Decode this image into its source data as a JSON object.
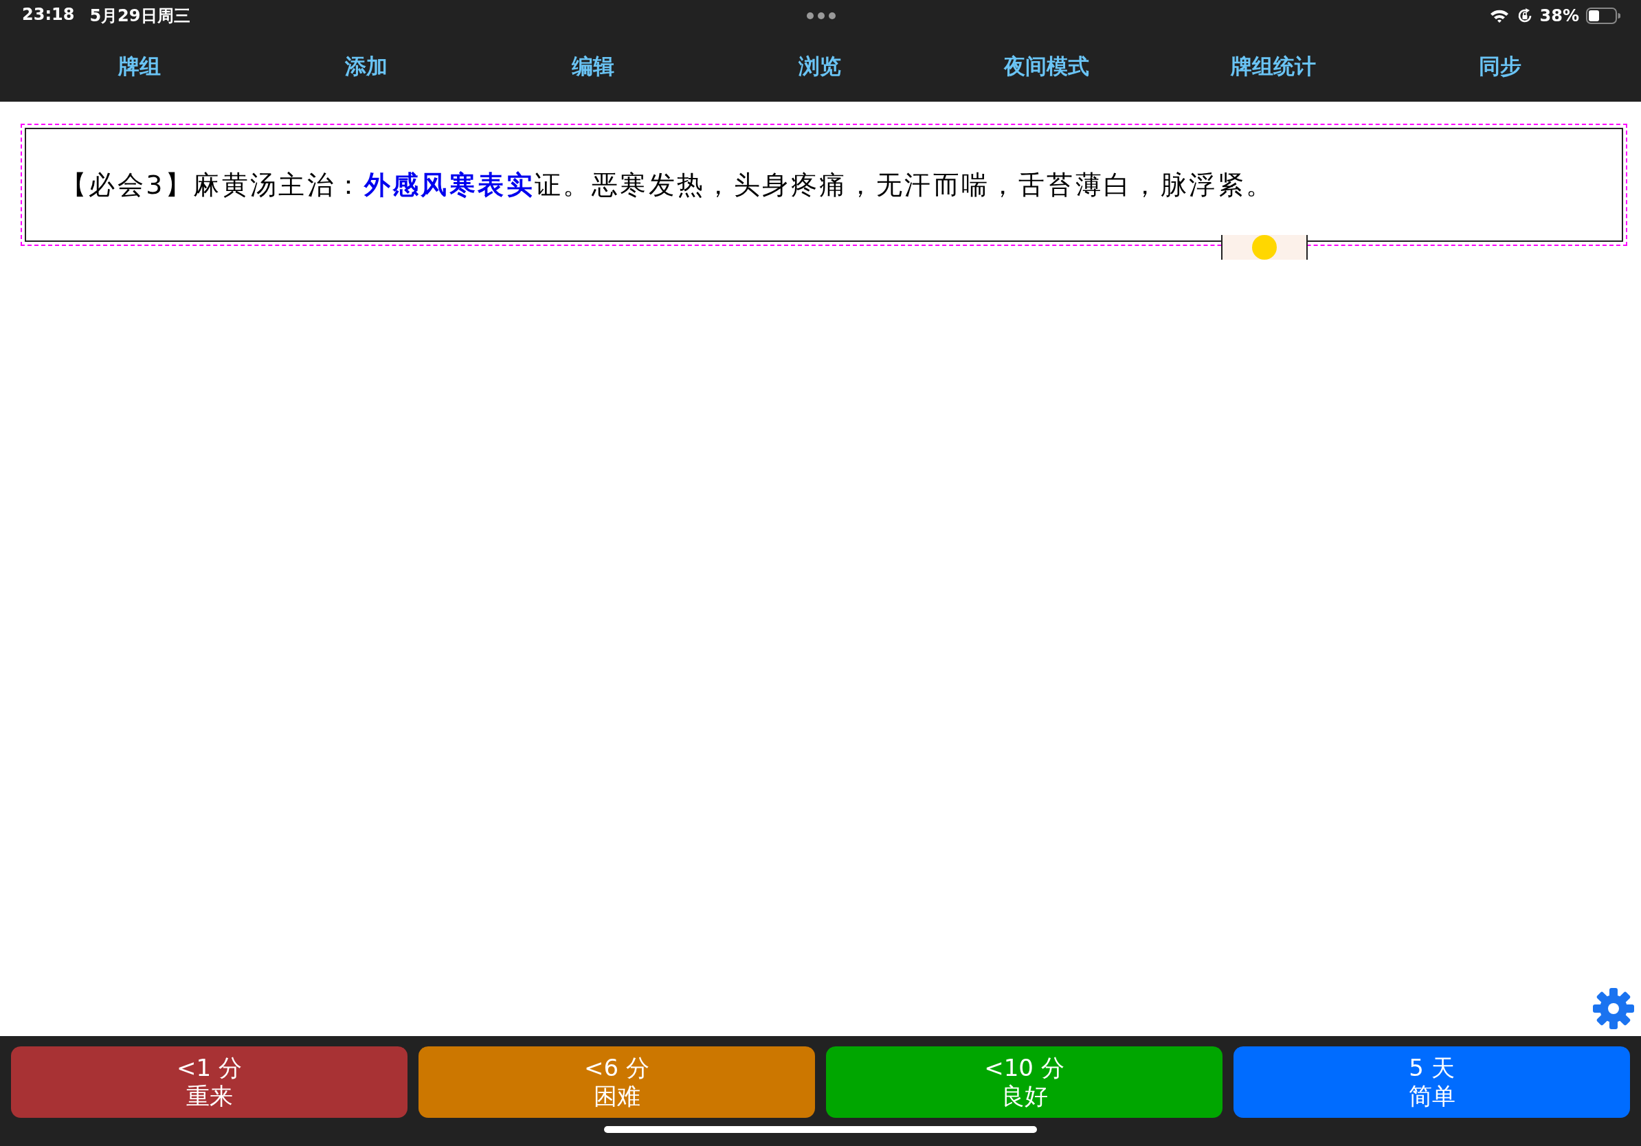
{
  "status_bar": {
    "time": "23:18",
    "date": "5月29日周三",
    "battery": "38%"
  },
  "toolbar": [
    "牌组",
    "添加",
    "编辑",
    "浏览",
    "夜间模式",
    "牌组统计",
    "同步"
  ],
  "card": {
    "text": "【必会3】麻黄汤主治：**外感风寒表实**证。恶寒发热，头身疼痛，无汗而喘，舌苔薄白，脉浮紧。"
  },
  "answer_buttons": [
    {
      "interval": "<1 分",
      "label": "重来",
      "color": "#a83234"
    },
    {
      "interval": "<6 分",
      "label": "困难",
      "color": "#cc7700"
    },
    {
      "interval": "<10 分",
      "label": "良好",
      "color": "#00a600"
    },
    {
      "interval": "5 天",
      "label": "简单",
      "color": "#006cff"
    }
  ]
}
